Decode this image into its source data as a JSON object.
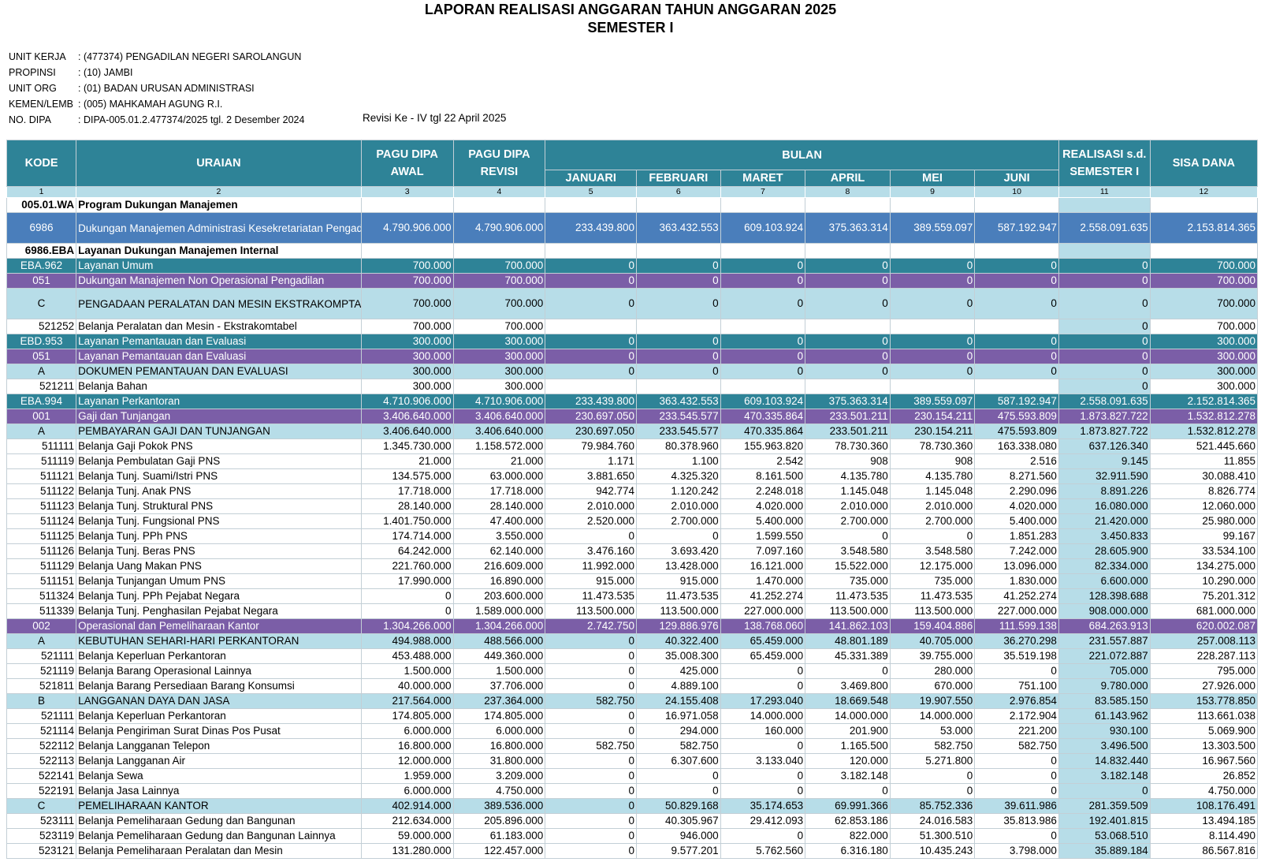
{
  "report": {
    "title": "LAPORAN REALISASI ANGGARAN TAHUN ANGGARAN 2025",
    "subtitle": "SEMESTER I",
    "info": [
      {
        "label": "UNIT KERJA",
        "value": ": (477374) PENGADILAN NEGERI SAROLANGUN"
      },
      {
        "label": "PROPINSI",
        "value": ": (10) JAMBI"
      },
      {
        "label": "UNIT ORG",
        "value": ": (01) BADAN URUSAN ADMINISTRASI"
      },
      {
        "label": "KEMEN/LEMB",
        "value": ": (005) MAHKAMAH AGUNG R.I."
      },
      {
        "label": "NO. DIPA",
        "value": ": DIPA-005.01.2.477374/2025 tgl. 2 Desember 2024"
      }
    ],
    "revisi": "Revisi Ke - IV tgl 22 April 2025"
  },
  "table": {
    "headers": {
      "kode": "KODE",
      "uraian": "URAIAN",
      "pagu_awal": "PAGU DIPA AWAL",
      "pagu_revisi": "PAGU DIPA REVISI",
      "bulan": "BULAN",
      "months": [
        "JANUARI",
        "FEBRUARI",
        "MARET",
        "APRIL",
        "MEI",
        "JUNI"
      ],
      "realisasi": "REALISASI s.d. SEMESTER I",
      "sisa": "SISA DANA",
      "col_numbers": [
        "1",
        "2",
        "3",
        "4",
        "5",
        "6",
        "7",
        "8",
        "9",
        "10",
        "11",
        "12"
      ]
    },
    "rows": [
      {
        "style": "bold",
        "kode": "005.01.WA",
        "uraian": "Program Dukungan Manajemen",
        "vals": [
          "",
          "",
          "",
          "",
          "",
          "",
          "",
          "",
          "",
          ""
        ]
      },
      {
        "style": "blue",
        "tall": true,
        "kode": "6986",
        "uraian": "Dukungan Manajemen Administrasi Kesekretariatan Pengadilan Tingkat Banding dan Tingkat Pertama",
        "vals": [
          "4.790.906.000",
          "4.790.906.000",
          "233.439.800",
          "363.432.553",
          "609.103.924",
          "375.363.314",
          "389.559.097",
          "587.192.947",
          "2.558.091.635",
          "2.153.814.365"
        ]
      },
      {
        "style": "bold",
        "kode": "6986.EBA",
        "uraian": "Layanan Dukungan Manajemen Internal",
        "vals": [
          "",
          "",
          "",
          "",
          "",
          "",
          "",
          "",
          "",
          ""
        ]
      },
      {
        "style": "teal",
        "kode": "EBA.962",
        "uraian": "Layanan Umum",
        "vals": [
          "700.000",
          "700.000",
          "0",
          "0",
          "0",
          "0",
          "0",
          "0",
          "0",
          "700.000"
        ]
      },
      {
        "style": "purple",
        "kode": "051",
        "uraian": "Dukungan Manajemen Non Operasional Pengadilan",
        "vals": [
          "700.000",
          "700.000",
          "0",
          "0",
          "0",
          "0",
          "0",
          "0",
          "0",
          "700.000"
        ]
      },
      {
        "style": "light",
        "tall": true,
        "kode": "C",
        "uraian": "PENGADAAN PERALATAN DAN MESIN EKSTRAKOMPTABEL",
        "vals": [
          "700.000",
          "700.000",
          "0",
          "0",
          "0",
          "0",
          "0",
          "0",
          "0",
          "700.000"
        ]
      },
      {
        "style": "plain",
        "kode": "521252",
        "uraian": "Belanja Peralatan dan Mesin - Ekstrakomtabel",
        "vals": [
          "700.000",
          "700.000",
          "",
          "",
          "",
          "",
          "",
          "",
          "0",
          "700.000"
        ]
      },
      {
        "style": "teal",
        "kode": "EBD.953",
        "uraian": "Layanan Pemantauan dan Evaluasi",
        "vals": [
          "300.000",
          "300.000",
          "0",
          "0",
          "0",
          "0",
          "0",
          "0",
          "0",
          "300.000"
        ]
      },
      {
        "style": "purple",
        "kode": "051",
        "uraian": "Layanan Pemantauan dan Evaluasi",
        "vals": [
          "300.000",
          "300.000",
          "0",
          "0",
          "0",
          "0",
          "0",
          "0",
          "0",
          "300.000"
        ]
      },
      {
        "style": "light",
        "kode": "A",
        "uraian": "DOKUMEN PEMANTAUAN DAN EVALUASI",
        "vals": [
          "300.000",
          "300.000",
          "0",
          "0",
          "0",
          "0",
          "0",
          "0",
          "0",
          "300.000"
        ]
      },
      {
        "style": "plain",
        "kode": "521211",
        "uraian": "Belanja Bahan",
        "vals": [
          "300.000",
          "300.000",
          "",
          "",
          "",
          "",
          "",
          "",
          "0",
          "300.000"
        ]
      },
      {
        "style": "teal",
        "kode": "EBA.994",
        "uraian": "Layanan Perkantoran",
        "vals": [
          "4.710.906.000",
          "4.710.906.000",
          "233.439.800",
          "363.432.553",
          "609.103.924",
          "375.363.314",
          "389.559.097",
          "587.192.947",
          "2.558.091.635",
          "2.152.814.365"
        ]
      },
      {
        "style": "purple",
        "kode": "001",
        "uraian": "Gaji dan Tunjangan",
        "vals": [
          "3.406.640.000",
          "3.406.640.000",
          "230.697.050",
          "233.545.577",
          "470.335.864",
          "233.501.211",
          "230.154.211",
          "475.593.809",
          "1.873.827.722",
          "1.532.812.278"
        ]
      },
      {
        "style": "light",
        "kode": "A",
        "uraian": "PEMBAYARAN GAJI DAN TUNJANGAN",
        "vals": [
          "3.406.640.000",
          "3.406.640.000",
          "230.697.050",
          "233.545.577",
          "470.335.864",
          "233.501.211",
          "230.154.211",
          "475.593.809",
          "1.873.827.722",
          "1.532.812.278"
        ]
      },
      {
        "style": "plain",
        "kode": "511111",
        "uraian": "Belanja Gaji Pokok PNS",
        "vals": [
          "1.345.730.000",
          "1.158.572.000",
          "79.984.760",
          "80.378.960",
          "155.963.820",
          "78.730.360",
          "78.730.360",
          "163.338.080",
          "637.126.340",
          "521.445.660"
        ]
      },
      {
        "style": "plain",
        "kode": "511119",
        "uraian": "Belanja Pembulatan Gaji PNS",
        "vals": [
          "21.000",
          "21.000",
          "1.171",
          "1.100",
          "2.542",
          "908",
          "908",
          "2.516",
          "9.145",
          "11.855"
        ]
      },
      {
        "style": "plain",
        "kode": "511121",
        "uraian": "Belanja Tunj. Suami/Istri PNS",
        "vals": [
          "134.575.000",
          "63.000.000",
          "3.881.650",
          "4.325.320",
          "8.161.500",
          "4.135.780",
          "4.135.780",
          "8.271.560",
          "32.911.590",
          "30.088.410"
        ]
      },
      {
        "style": "plain",
        "kode": "511122",
        "uraian": "Belanja Tunj. Anak PNS",
        "vals": [
          "17.718.000",
          "17.718.000",
          "942.774",
          "1.120.242",
          "2.248.018",
          "1.145.048",
          "1.145.048",
          "2.290.096",
          "8.891.226",
          "8.826.774"
        ]
      },
      {
        "style": "plain",
        "kode": "511123",
        "uraian": "Belanja Tunj. Struktural PNS",
        "vals": [
          "28.140.000",
          "28.140.000",
          "2.010.000",
          "2.010.000",
          "4.020.000",
          "2.010.000",
          "2.010.000",
          "4.020.000",
          "16.080.000",
          "12.060.000"
        ]
      },
      {
        "style": "plain",
        "kode": "511124",
        "uraian": "Belanja Tunj. Fungsional PNS",
        "vals": [
          "1.401.750.000",
          "47.400.000",
          "2.520.000",
          "2.700.000",
          "5.400.000",
          "2.700.000",
          "2.700.000",
          "5.400.000",
          "21.420.000",
          "25.980.000"
        ]
      },
      {
        "style": "plain",
        "kode": "511125",
        "uraian": "Belanja Tunj. PPh PNS",
        "vals": [
          "174.714.000",
          "3.550.000",
          "0",
          "0",
          "1.599.550",
          "0",
          "0",
          "1.851.283",
          "3.450.833",
          "99.167"
        ]
      },
      {
        "style": "plain",
        "kode": "511126",
        "uraian": "Belanja Tunj. Beras PNS",
        "vals": [
          "64.242.000",
          "62.140.000",
          "3.476.160",
          "3.693.420",
          "7.097.160",
          "3.548.580",
          "3.548.580",
          "7.242.000",
          "28.605.900",
          "33.534.100"
        ]
      },
      {
        "style": "plain",
        "kode": "511129",
        "uraian": "Belanja Uang Makan PNS",
        "vals": [
          "221.760.000",
          "216.609.000",
          "11.992.000",
          "13.428.000",
          "16.121.000",
          "15.522.000",
          "12.175.000",
          "13.096.000",
          "82.334.000",
          "134.275.000"
        ]
      },
      {
        "style": "plain",
        "kode": "511151",
        "uraian": "Belanja Tunjangan Umum PNS",
        "vals": [
          "17.990.000",
          "16.890.000",
          "915.000",
          "915.000",
          "1.470.000",
          "735.000",
          "735.000",
          "1.830.000",
          "6.600.000",
          "10.290.000"
        ]
      },
      {
        "style": "plain",
        "kode": "511324",
        "uraian": "Belanja Tunj. PPh Pejabat Negara",
        "vals": [
          "0",
          "203.600.000",
          "11.473.535",
          "11.473.535",
          "41.252.274",
          "11.473.535",
          "11.473.535",
          "41.252.274",
          "128.398.688",
          "75.201.312"
        ]
      },
      {
        "style": "plain",
        "kode": "511339",
        "uraian": "Belanja Tunj. Penghasilan Pejabat Negara",
        "vals": [
          "0",
          "1.589.000.000",
          "113.500.000",
          "113.500.000",
          "227.000.000",
          "113.500.000",
          "113.500.000",
          "227.000.000",
          "908.000.000",
          "681.000.000"
        ]
      },
      {
        "style": "purple",
        "kode": "002",
        "uraian": "Operasional dan Pemeliharaan Kantor",
        "vals": [
          "1.304.266.000",
          "1.304.266.000",
          "2.742.750",
          "129.886.976",
          "138.768.060",
          "141.862.103",
          "159.404.886",
          "111.599.138",
          "684.263.913",
          "620.002.087"
        ]
      },
      {
        "style": "light",
        "kode": "A",
        "uraian": "KEBUTUHAN SEHARI-HARI PERKANTORAN",
        "vals": [
          "494.988.000",
          "488.566.000",
          "0",
          "40.322.400",
          "65.459.000",
          "48.801.189",
          "40.705.000",
          "36.270.298",
          "231.557.887",
          "257.008.113"
        ]
      },
      {
        "style": "plain",
        "kode": "521111",
        "uraian": "Belanja Keperluan Perkantoran",
        "vals": [
          "453.488.000",
          "449.360.000",
          "0",
          "35.008.300",
          "65.459.000",
          "45.331.389",
          "39.755.000",
          "35.519.198",
          "221.072.887",
          "228.287.113"
        ]
      },
      {
        "style": "plain",
        "kode": "521119",
        "uraian": "Belanja Barang Operasional Lainnya",
        "vals": [
          "1.500.000",
          "1.500.000",
          "0",
          "425.000",
          "0",
          "0",
          "280.000",
          "0",
          "705.000",
          "795.000"
        ]
      },
      {
        "style": "plain",
        "kode": "521811",
        "uraian": "Belanja Barang Persediaan Barang Konsumsi",
        "vals": [
          "40.000.000",
          "37.706.000",
          "0",
          "4.889.100",
          "0",
          "3.469.800",
          "670.000",
          "751.100",
          "9.780.000",
          "27.926.000"
        ]
      },
      {
        "style": "light",
        "kode": "B",
        "uraian": "LANGGANAN DAYA DAN JASA",
        "vals": [
          "217.564.000",
          "237.364.000",
          "582.750",
          "24.155.408",
          "17.293.040",
          "18.669.548",
          "19.907.550",
          "2.976.854",
          "83.585.150",
          "153.778.850"
        ]
      },
      {
        "style": "plain",
        "kode": "521111",
        "uraian": "Belanja Keperluan Perkantoran",
        "vals": [
          "174.805.000",
          "174.805.000",
          "0",
          "16.971.058",
          "14.000.000",
          "14.000.000",
          "14.000.000",
          "2.172.904",
          "61.143.962",
          "113.661.038"
        ]
      },
      {
        "style": "plain",
        "kode": "521114",
        "uraian": "Belanja Pengiriman Surat Dinas Pos Pusat",
        "vals": [
          "6.000.000",
          "6.000.000",
          "0",
          "294.000",
          "160.000",
          "201.900",
          "53.000",
          "221.200",
          "930.100",
          "5.069.900"
        ]
      },
      {
        "style": "plain",
        "kode": "522112",
        "uraian": "Belanja Langganan Telepon",
        "vals": [
          "16.800.000",
          "16.800.000",
          "582.750",
          "582.750",
          "0",
          "1.165.500",
          "582.750",
          "582.750",
          "3.496.500",
          "13.303.500"
        ]
      },
      {
        "style": "plain",
        "kode": "522113",
        "uraian": "Belanja Langganan Air",
        "vals": [
          "12.000.000",
          "31.800.000",
          "0",
          "6.307.600",
          "3.133.040",
          "120.000",
          "5.271.800",
          "0",
          "14.832.440",
          "16.967.560"
        ]
      },
      {
        "style": "plain",
        "kode": "522141",
        "uraian": "Belanja Sewa",
        "vals": [
          "1.959.000",
          "3.209.000",
          "0",
          "0",
          "0",
          "3.182.148",
          "0",
          "0",
          "3.182.148",
          "26.852"
        ]
      },
      {
        "style": "plain",
        "kode": "522191",
        "uraian": "Belanja Jasa Lainnya",
        "vals": [
          "6.000.000",
          "4.750.000",
          "0",
          "0",
          "0",
          "0",
          "0",
          "0",
          "0",
          "4.750.000"
        ]
      },
      {
        "style": "light",
        "kode": "C",
        "uraian": "PEMELIHARAAN KANTOR",
        "vals": [
          "402.914.000",
          "389.536.000",
          "0",
          "50.829.168",
          "35.174.653",
          "69.991.366",
          "85.752.336",
          "39.611.986",
          "281.359.509",
          "108.176.491"
        ]
      },
      {
        "style": "plain",
        "kode": "523111",
        "uraian": "Belanja Pemeliharaan Gedung dan Bangunan",
        "vals": [
          "212.634.000",
          "205.896.000",
          "0",
          "40.305.967",
          "29.412.093",
          "62.853.186",
          "24.016.583",
          "35.813.986",
          "192.401.815",
          "13.494.185"
        ]
      },
      {
        "style": "plain",
        "kode": "523119",
        "uraian": "Belanja Pemeliharaan Gedung dan Bangunan Lainnya",
        "vals": [
          "59.000.000",
          "61.183.000",
          "0",
          "946.000",
          "0",
          "822.000",
          "51.300.510",
          "0",
          "53.068.510",
          "8.114.490"
        ]
      },
      {
        "style": "plain",
        "kode": "523121",
        "uraian": "Belanja Pemeliharaan Peralatan dan Mesin",
        "vals": [
          "131.280.000",
          "122.457.000",
          "0",
          "9.577.201",
          "5.762.560",
          "6.316.180",
          "10.435.243",
          "3.798.000",
          "35.889.184",
          "86.567.816"
        ]
      }
    ]
  }
}
